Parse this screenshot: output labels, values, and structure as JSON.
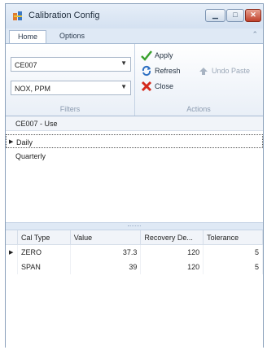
{
  "window": {
    "title": "Calibration Config"
  },
  "ribbon": {
    "tabs": [
      "Home",
      "Options"
    ],
    "filters": {
      "unit_combo": "CE007",
      "param_combo": "NOX, PPM",
      "group_label": "Filters"
    },
    "actions": {
      "apply": "Apply",
      "refresh": "Refresh",
      "undo_paste": "Undo Paste",
      "close": "Close",
      "group_label": "Actions"
    }
  },
  "schedule_panel": {
    "header": "CE007 - Use",
    "rows": [
      "Daily",
      "Quarterly"
    ]
  },
  "cal_grid": {
    "columns": [
      "Cal Type",
      "Value",
      "Recovery De...",
      "Tolerance"
    ],
    "rows": [
      {
        "cal_type": "ZERO",
        "value": "37.3",
        "recovery": "120",
        "tolerance": "5"
      },
      {
        "cal_type": "SPAN",
        "value": "39",
        "recovery": "120",
        "tolerance": "5"
      }
    ]
  },
  "colors": {
    "title_bg": "#d4e1f1",
    "close_button": "#c0412b",
    "apply_check": "#3aa12f",
    "close_x": "#d42a1c"
  }
}
